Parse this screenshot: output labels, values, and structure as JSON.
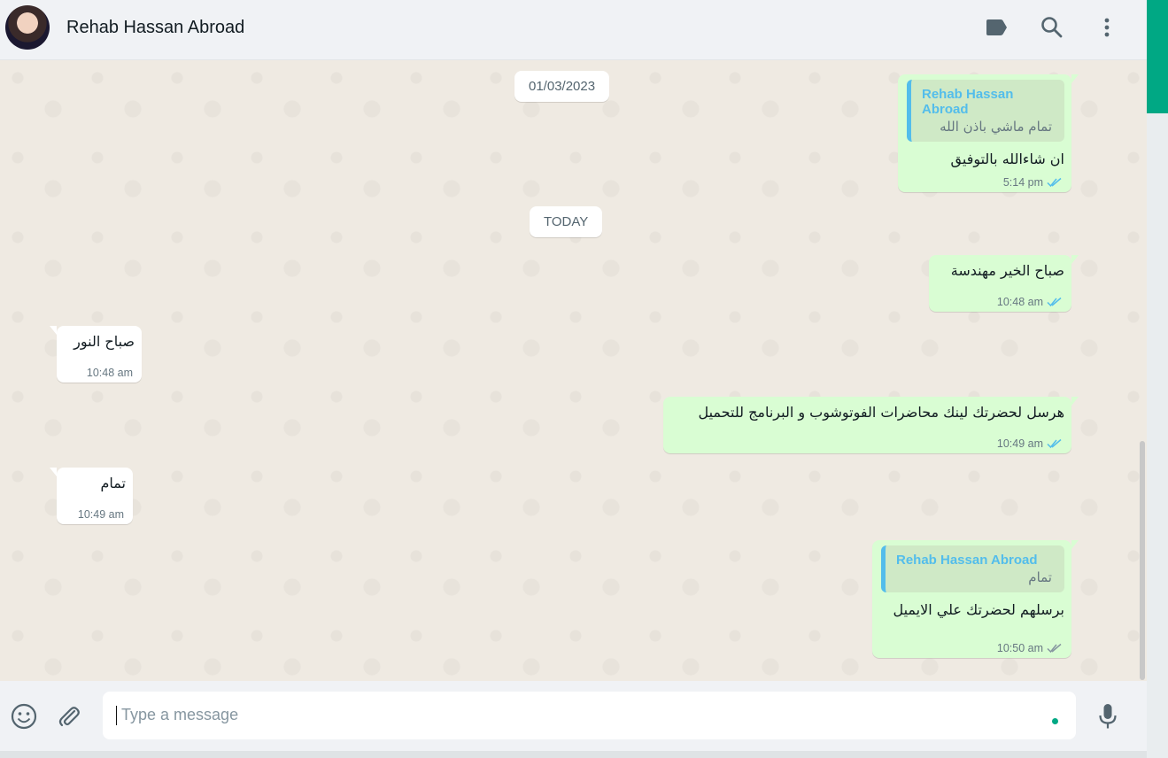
{
  "header": {
    "contact_name": "Rehab Hassan Abroad",
    "icons": [
      "label-icon",
      "search-icon",
      "menu-icon"
    ]
  },
  "chat": {
    "date_chip_1": "01/03/2023",
    "date_chip_2": "TODAY",
    "messages": [
      {
        "direction": "out",
        "quote_author": "Rehab Hassan Abroad",
        "quote_text": "تمام ماشي باذن الله",
        "text": "ان شاءالله بالتوفيق",
        "time": "5:14 pm",
        "status": "read"
      },
      {
        "direction": "out",
        "text": "صباح الخير مهندسة",
        "time": "10:48 am",
        "status": "read"
      },
      {
        "direction": "in",
        "text": "صباح النور",
        "time": "10:48 am"
      },
      {
        "direction": "out",
        "text": "هرسل لحضرتك لينك محاضرات الفوتوشوب و البرنامج للتحميل",
        "time": "10:49 am",
        "status": "read"
      },
      {
        "direction": "in",
        "text": "تمام",
        "time": "10:49 am"
      },
      {
        "direction": "out",
        "quote_author": "Rehab Hassan Abroad",
        "quote_text": "تمام",
        "text": "برسلهم لحضرتك علي الايميل",
        "time": "10:50 am",
        "status": "delivered"
      }
    ]
  },
  "composer": {
    "placeholder": "Type a message"
  },
  "colors": {
    "outgoing_bubble": "#d9fdd3",
    "incoming_bubble": "#ffffff",
    "read_tick": "#53bdeb",
    "accent": "#00a884"
  }
}
